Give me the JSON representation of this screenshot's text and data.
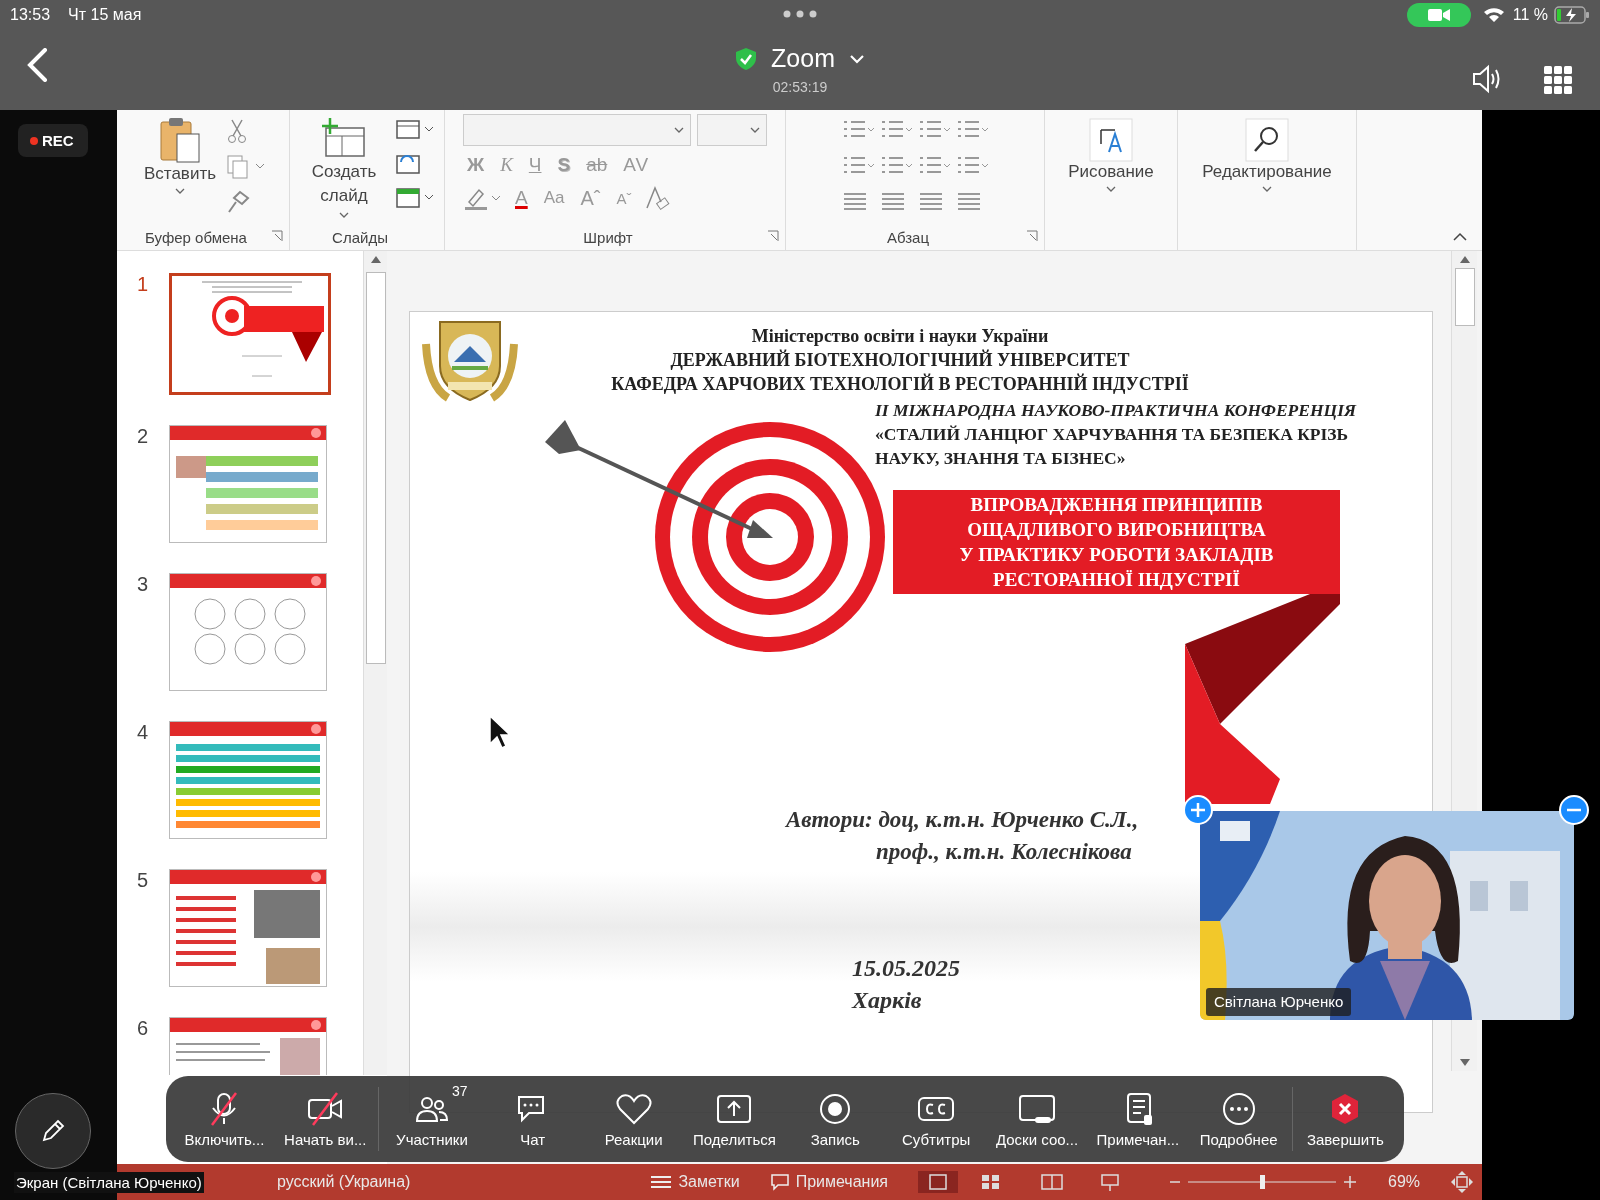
{
  "device_status": {
    "time": "13:53",
    "date": "Чт 15 мая",
    "battery": "11 %"
  },
  "meeting": {
    "title": "Zoom",
    "elapsed": "02:53:19",
    "recording": "REC"
  },
  "ribbon": {
    "paste": "Вставить",
    "new_slide": "Создать слайд",
    "drawing": "Рисование",
    "editing": "Редактирование",
    "groups": [
      "Буфер обмена",
      "Слайды",
      "Шрифт",
      "Абзац"
    ],
    "font_row_1": [
      {
        "text": "Ж",
        "kind": "bold"
      },
      {
        "text": "К",
        "kind": "italic"
      },
      {
        "text": "Ч",
        "kind": "underline"
      },
      {
        "text": "S",
        "kind": "shadow"
      },
      {
        "text": "ab",
        "kind": "strike"
      },
      {
        "text": "AV",
        "kind": "spacing"
      }
    ],
    "font_row_2": [
      {
        "text": "A",
        "kind": "color"
      },
      {
        "text": "Aa",
        "kind": "case"
      },
      {
        "text": "Aˆ",
        "kind": "grow"
      },
      {
        "text": "Aˇ",
        "kind": "shrink"
      }
    ]
  },
  "thumbnails": [
    {
      "number": "1",
      "selected": true,
      "kind": "title"
    },
    {
      "number": "2",
      "selected": false,
      "kind": "list"
    },
    {
      "number": "3",
      "selected": false,
      "kind": "diagram"
    },
    {
      "number": "4",
      "selected": false,
      "kind": "table"
    },
    {
      "number": "5",
      "selected": false
    },
    {
      "number": "6",
      "selected": false,
      "kind": "text"
    }
  ],
  "slide": {
    "header": [
      "Міністерство освіти і науки України",
      "ДЕРЖАВНИЙ БІОТЕХНОЛОГІЧНИЙ УНІВЕРСИТЕТ",
      "КАФЕДРА ХАРЧОВИХ ТЕХНОЛОГІЙ В РЕСТОРАННІЙ ІНДУСТРІЇ"
    ],
    "conference": [
      "II МІЖНАРОДНА НАУКОВО-ПРАКТИЧНА КОНФЕРЕНЦІЯ",
      "«СТАЛИЙ ЛАНЦЮГ ХАРЧУВАННЯ ТА БЕЗПЕКА КРІЗЬ",
      "НАУКУ, ЗНАННЯ ТА БІЗНЕС»"
    ],
    "title": [
      "ВПРОВАДЖЕННЯ ПРИНЦИПІВ",
      "ОЩАДЛИВОГО ВИРОБНИЦТВА",
      "У ПРАКТИКУ РОБОТИ ЗАКЛАДІВ",
      "РЕСТОРАННОЇ ІНДУСТРІЇ"
    ],
    "authors": [
      "Автори: доц, к.т.н. Юрченко С.Л.,",
      "проф., к.т.н. Колеснікова"
    ],
    "date": "15.05.2025",
    "city": "Харків"
  },
  "video": {
    "name": "Світлана Юрченко"
  },
  "screen_label": "Экран (Світлана Юрченко)",
  "toolbar": [
    {
      "label": "Включить...",
      "kind": "mic",
      "off": true
    },
    {
      "label": "Начать ви...",
      "kind": "camera",
      "off": true
    },
    {
      "label": "Участники",
      "kind": "participants",
      "off": false,
      "count": "37"
    },
    {
      "label": "Чат",
      "kind": "chat",
      "off": false
    },
    {
      "label": "Реакции",
      "kind": "heart",
      "off": false
    },
    {
      "label": "Поделиться",
      "kind": "share",
      "off": false
    },
    {
      "label": "Запись",
      "kind": "record",
      "off": false
    },
    {
      "label": "Субтитры",
      "kind": "cc",
      "off": false
    },
    {
      "label": "Доски соо...",
      "kind": "board",
      "off": false
    },
    {
      "label": "Примечан...",
      "kind": "notes",
      "off": false
    },
    {
      "label": "Подробнее",
      "kind": "more",
      "off": false
    },
    {
      "label": "Завершить",
      "kind": "end",
      "off": false
    }
  ],
  "app_status": {
    "language": "русский (Украина)",
    "notes": "Заметки",
    "comments": "Примечания",
    "zoom": "69%",
    "zoom_slider": {
      "level": 0.5
    }
  }
}
